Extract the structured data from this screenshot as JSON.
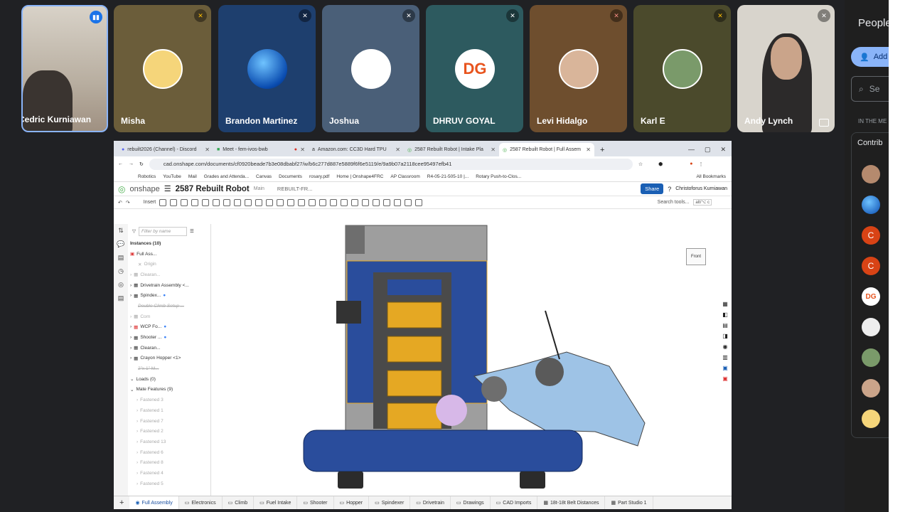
{
  "participants": [
    {
      "name": "Cedric Kurniawan"
    },
    {
      "name": "Misha"
    },
    {
      "name": "Brandon Martinez"
    },
    {
      "name": "Joshua"
    },
    {
      "name": "DHRUV GOYAL"
    },
    {
      "name": "Levi Hidalgo"
    },
    {
      "name": "Karl E"
    },
    {
      "name": "Andy Lynch"
    }
  ],
  "side_panel": {
    "title": "People",
    "add_label": "Add",
    "search_label": "Se",
    "section_label": "IN THE ME",
    "contrib_label": "Contrib"
  },
  "browser": {
    "tabs": [
      {
        "label": "rebuilt2026 (Channel) - Discord"
      },
      {
        "label": "Meet - fem-ivos-bwb"
      },
      {
        "label": "Amazon.com: CC3D Hard TPU"
      },
      {
        "label": "2587 Rebuilt Robot | Intake Pla"
      },
      {
        "label": "2587 Rebuilt Robot | Full Assem"
      }
    ],
    "url": "cad.onshape.com/documents/cf0920beade7b3e08dbabf27/w/b6c277d887e5889f6f6e5119/e/9a9b07a2118cee95497efb41",
    "bookmarks": [
      "Robotics",
      "YouTube",
      "Mail",
      "Grades and Attenda...",
      "Canvas",
      "Documents",
      "rosary.pdf",
      "Home | Onshape4FRC",
      "AP Classroom",
      "R4-05-21-505-10 |...",
      "Rotary Push-to-Clos...",
      "All Bookmarks"
    ]
  },
  "onshape": {
    "logo": "onshape",
    "doc_title": "2587 Rebuilt Robot",
    "branch": "Main",
    "folder": "REBUILT-FR...",
    "share_label": "Share",
    "user": "Christoforus Kurniawan",
    "insert_label": "Insert",
    "search_tools": "Search tools...",
    "search_shortcut": "alt/⌥ c",
    "filter_placeholder": "Filter by name",
    "instances_header": "Instances (10)",
    "tree": [
      {
        "label": "Full Ass..."
      },
      {
        "label": "Origin"
      },
      {
        "label": "Clearan..."
      },
      {
        "label": "Drivetrain Assembly <..."
      },
      {
        "label": "Spindex..."
      },
      {
        "label": "Double Climb Setup ..."
      },
      {
        "label": "Corn"
      },
      {
        "label": "WCP Fo..."
      },
      {
        "label": "Shooter ..."
      },
      {
        "label": "Clearan..."
      },
      {
        "label": "Crayon Hopper <1>"
      },
      {
        "label": "2\"x 1\" M..."
      }
    ],
    "loads": "Loads (0)",
    "mate_features": "Mate Features (9)",
    "mates": [
      "Fastened 3",
      "Fastened 1",
      "Fastened 7",
      "Fastened 2",
      "Fastened 13",
      "Fastened 6",
      "Fastened 8",
      "Fastened 4",
      "Fastened 5"
    ],
    "view_cube_label": "Front",
    "bottom_tabs": [
      "Full Assembly",
      "Electronics",
      "Climb",
      "Fuel Intake",
      "Shooter",
      "Hopper",
      "Spindexer",
      "Drivetrain",
      "Drawings",
      "CAD Imports",
      "18t-18t Belt Distances",
      "Part Studio 1"
    ]
  },
  "colors": {
    "meet_bg": "#202124",
    "onshape_green": "#4caf50",
    "share_blue": "#1a5fb4",
    "robot_blue": "#2a4d9c",
    "robot_yellow": "#e5a823"
  }
}
